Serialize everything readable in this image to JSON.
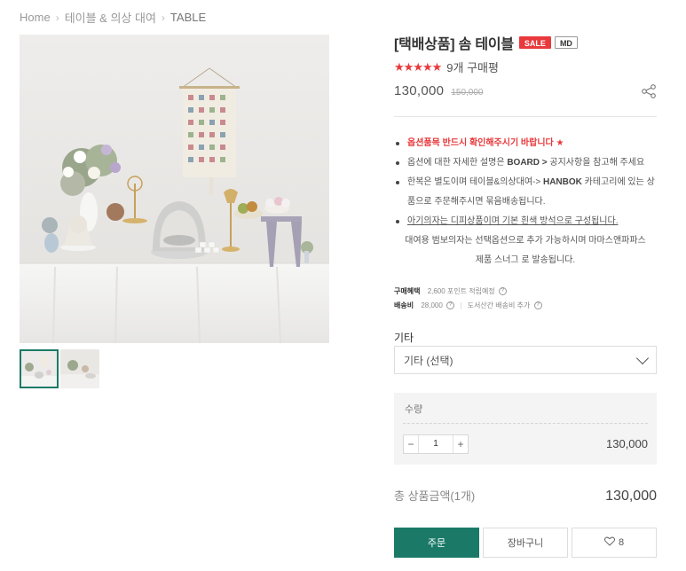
{
  "breadcrumb": {
    "home": "Home",
    "category": "테이블 & 의상 대여",
    "current": "TABLE"
  },
  "product": {
    "title": "[택배상품] 솜 테이블",
    "badges": {
      "sale": "SALE",
      "md": "MD"
    },
    "rating": 5,
    "review_count": "9개 구매평",
    "price": "130,000",
    "original_price": "150,000"
  },
  "notes": {
    "line1": "옵션품목 반드시 확인해주시기 바랍니다 ★",
    "line2_pre": "옵션에 대한 자세한 설명은 ",
    "line2_bold": "BOARD > ",
    "line2_post": "공지사항을 참고해 주세요",
    "line3_pre": "한복은 별도이며 테이블&의상대여-> ",
    "line3_bold": "HANBOK",
    "line3_post": " 카테고리에 있는 상",
    "line3_cont": "품으로 주문해주시면 묶음배송됩니다.",
    "line4": "아기의자는 디피상품이며 기본 흰색 방석으로 구성됩니다.",
    "line5": "대여용 범보의자는 선택옵션으로 추가 가능하시며 마마스앤파파스",
    "line6": "제품 스너그 로 발송됩니다."
  },
  "meta": {
    "purchase_label": "구매혜택",
    "purchase_value": "2,600 포인트 적립예정",
    "shipping_label": "배송비",
    "shipping_value": "28,000",
    "shipping_extra": "도서산간 배송비 추가"
  },
  "option": {
    "label": "기타",
    "selected": "기타 (선택)"
  },
  "quantity": {
    "label": "수량",
    "value": "1",
    "minus": "−",
    "plus": "+",
    "line_price": "130,000"
  },
  "total": {
    "label": "총 상품금액(1개)",
    "price": "130,000"
  },
  "actions": {
    "buy": "주문",
    "cart": "장바구니",
    "wish_count": "8"
  },
  "colors": {
    "accent": "#1b7a67",
    "sale": "#e8393c"
  },
  "icons": {
    "share": "share-icon",
    "heart": "heart-icon",
    "chevron": "chevron-down-icon",
    "star": "star-icon",
    "help": "question-circle-icon"
  }
}
